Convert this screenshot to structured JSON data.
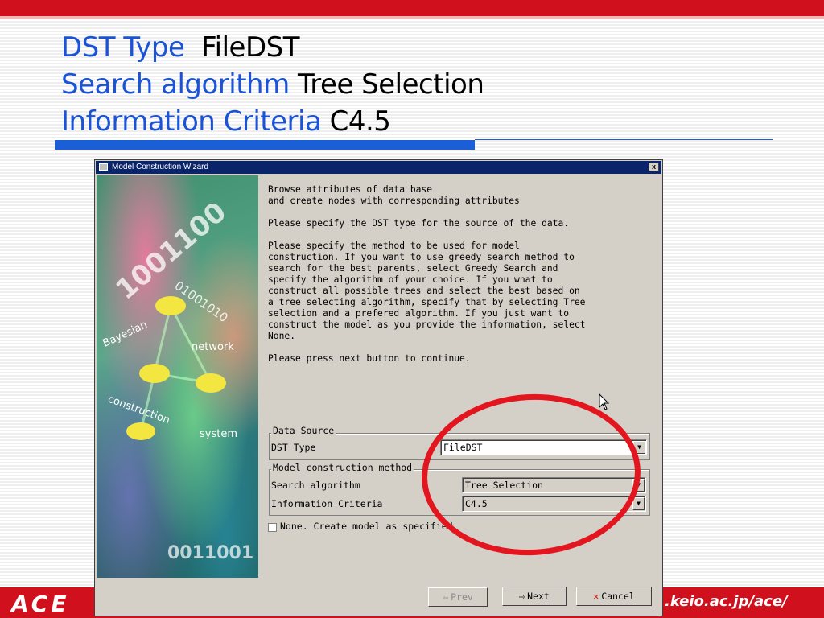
{
  "slide": {
    "headings": [
      {
        "label": "DST Type",
        "value": "FileDST"
      },
      {
        "label": "Search algorithm",
        "value": "Tree Selection"
      },
      {
        "label": "Information Criteria",
        "value": "C4.5"
      }
    ],
    "footer": {
      "logo": "ACE",
      "url_fragment": ".keio.ac.jp/ace/"
    },
    "colors": {
      "accent_red": "#d0101c",
      "heading_blue": "#1a53d6",
      "highlight_circle": "#e3161f"
    }
  },
  "window": {
    "title": "Model Construction Wizard",
    "close_glyph": "x",
    "art": {
      "words": [
        "Bayesian",
        "network",
        "construction",
        "system"
      ],
      "big_digits": "1001100",
      "small_digits": "01001010",
      "bottom_digits": "0011001"
    },
    "instructions": [
      "Browse attributes of data base\nand create nodes with corresponding attributes",
      "Please specify the DST type for the source of the data.",
      "Please specify the method to be used for model\nconstruction. If you want to use greedy search method to\nsearch for the best parents, select Greedy Search and\nspecify the algorithm of your choice. If you wnat to\nconstruct all possible trees and select the best based on\na tree selecting algorithm, specify that by selecting Tree\nselection and a prefered algorithm. If you just want to\nconstruct the model as you provide the information, select\nNone.",
      "Please press next button to continue."
    ],
    "data_source": {
      "legend": "Data Source",
      "dst_type_label": "DST Type",
      "dst_type_value": "FileDST"
    },
    "method": {
      "legend": "Model construction method",
      "search_label": "Search algorithm",
      "search_value": "Tree Selection",
      "criteria_label": "Information Criteria",
      "criteria_value": "C4.5"
    },
    "none_checkbox": {
      "label": "None. Create model as specified.",
      "checked": false
    },
    "buttons": {
      "prev": "Prev",
      "next": "Next",
      "cancel": "Cancel"
    }
  }
}
